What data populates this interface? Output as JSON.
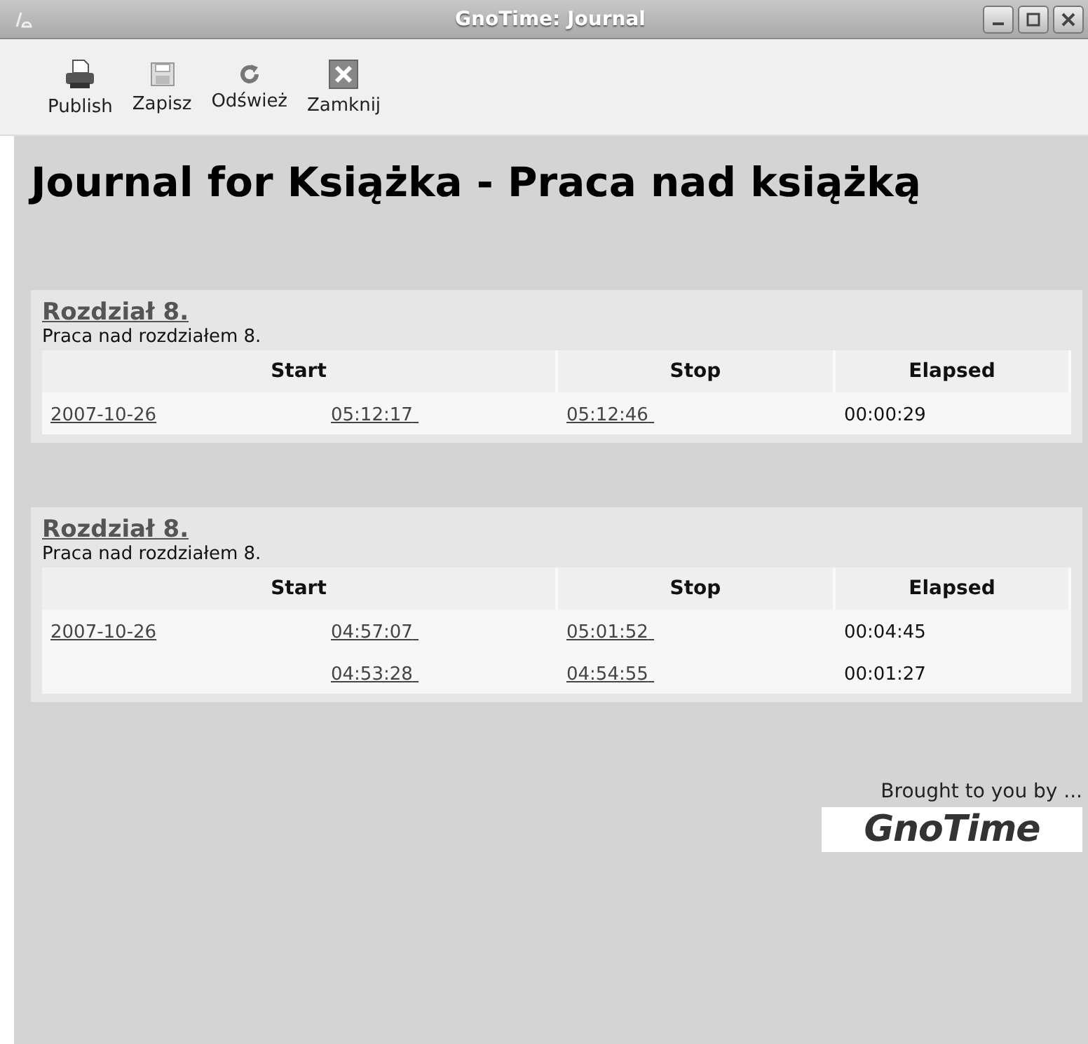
{
  "window": {
    "title": "GnoTime: Journal"
  },
  "toolbar": [
    {
      "label": "Publish",
      "kind": "print"
    },
    {
      "label": "Zapisz",
      "kind": "save"
    },
    {
      "label": "Odśwież",
      "kind": "refresh"
    },
    {
      "label": "Zamknij",
      "kind": "close"
    }
  ],
  "heading": "Journal for Książka - Praca nad książką",
  "sections": [
    {
      "title": "Rozdział 8.",
      "description": "Praca nad rozdziałem 8.",
      "columns": [
        "Start",
        "Stop",
        "Elapsed"
      ],
      "rows": [
        {
          "date": "2007-10-26",
          "start": "05:12:17",
          "stop": "05:12:46",
          "elapsed": "00:00:29"
        }
      ]
    },
    {
      "title": "Rozdział 8.",
      "description": "Praca nad rozdziałem 8.",
      "columns": [
        "Start",
        "Stop",
        "Elapsed"
      ],
      "rows": [
        {
          "date": "2007-10-26",
          "start": "04:57:07",
          "stop": "05:01:52",
          "elapsed": "00:04:45"
        },
        {
          "start": "04:53:28",
          "stop": "04:54:55",
          "elapsed": "00:01:27"
        }
      ]
    }
  ],
  "footer": {
    "credit": "Brought to you by ...",
    "logo": "GnoTime"
  }
}
